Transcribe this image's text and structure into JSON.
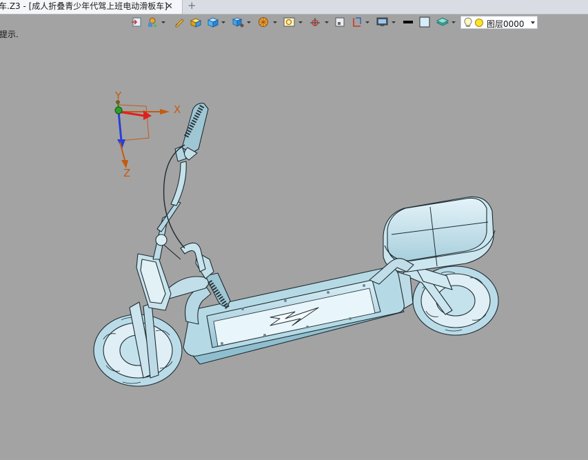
{
  "tab": {
    "title": "车.Z3 - [成人折叠青少年代驾上班电动滑板车]",
    "close_icon": "close-icon",
    "new_tab_icon": "plus-icon"
  },
  "toolbar": {
    "buttons": [
      "open-file-icon",
      "shape-tools-icon",
      "edit-pencil-icon",
      "solid-block-icon",
      "view-cube-icon",
      "view-orientation-icon",
      "render-mode-icon",
      "zoom-fit-icon",
      "axis-triad-icon",
      "sketch-plane-icon",
      "section-icon",
      "display-icon",
      "line-color-icon",
      "fill-color-icon",
      "layer-toggle-icon"
    ],
    "layer": {
      "label": "图层0000",
      "bulb_icon": "lightbulb-icon",
      "dot_color": "#ffe22a"
    }
  },
  "prompt": "提示.",
  "viewport": {
    "background": "#a3a3a3",
    "model": "electric-scooter-wireframe",
    "triad": {
      "x": "X",
      "y": "Y",
      "z": "Z"
    }
  }
}
